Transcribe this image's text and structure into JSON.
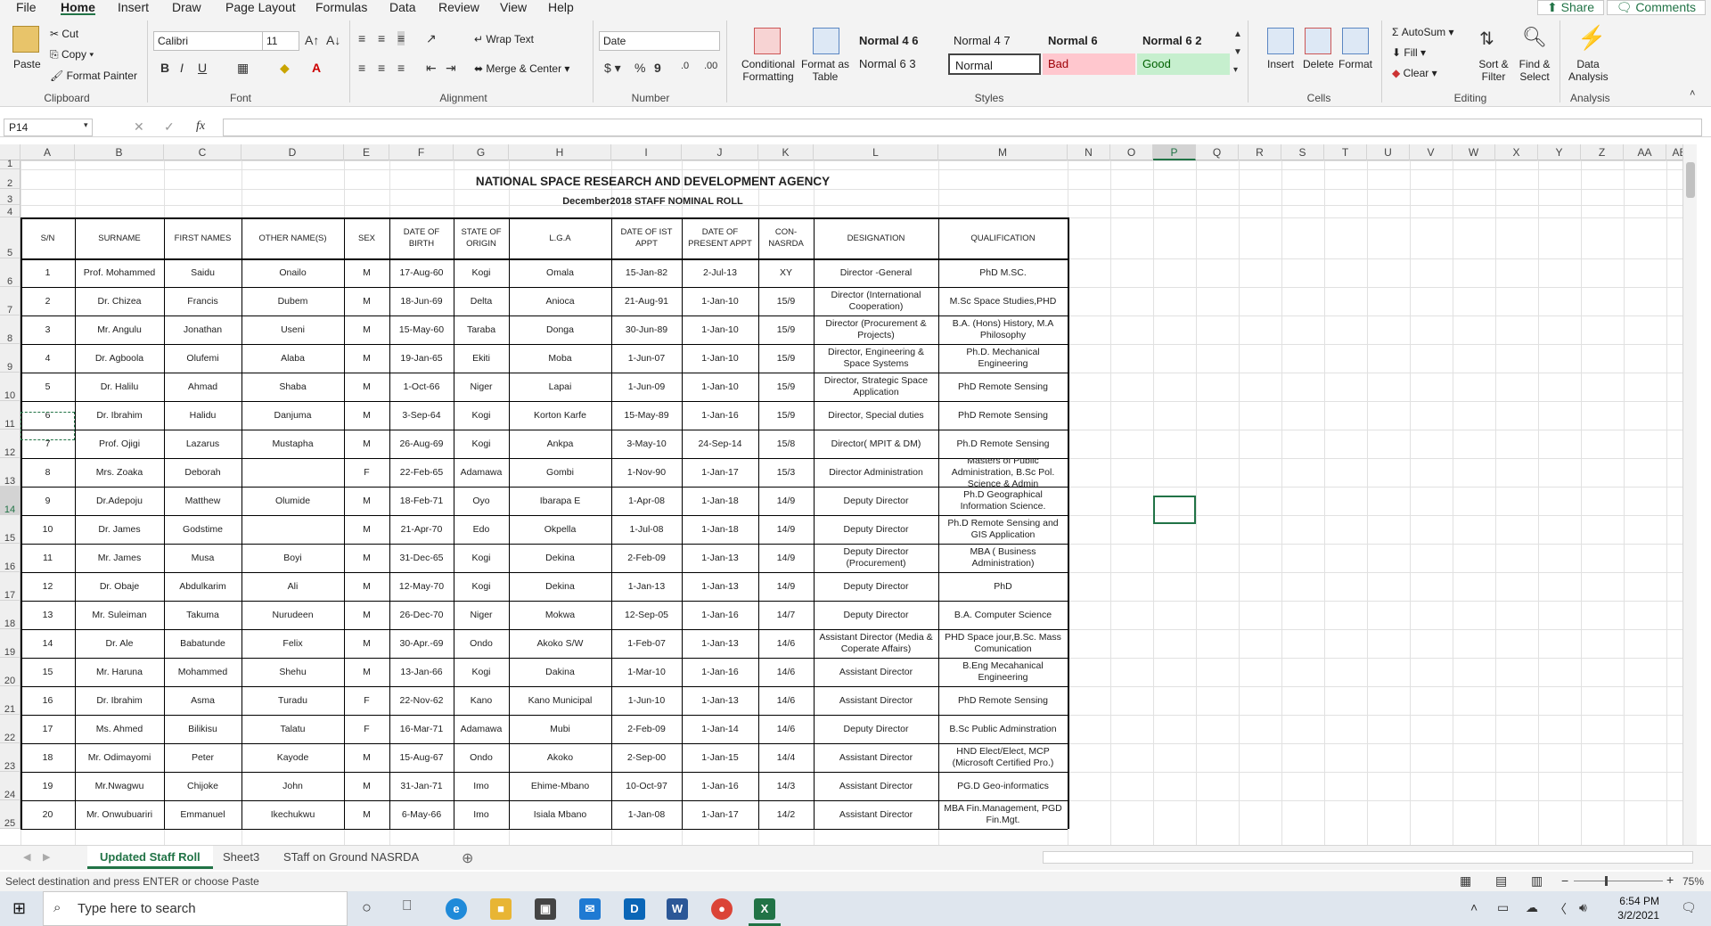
{
  "menu": {
    "tabs": [
      "File",
      "Home",
      "Insert",
      "Draw",
      "Page Layout",
      "Formulas",
      "Data",
      "Review",
      "View",
      "Help"
    ],
    "share": "Share",
    "comments": "Comments"
  },
  "ribbon": {
    "clipboard": {
      "paste": "Paste",
      "cut": "Cut",
      "copy": "Copy",
      "format_painter": "Format Painter",
      "label": "Clipboard"
    },
    "font": {
      "name": "Calibri",
      "size": "11",
      "label": "Font"
    },
    "alignment": {
      "wrap": "Wrap Text",
      "merge": "Merge & Center",
      "label": "Alignment"
    },
    "number": {
      "format": "Date",
      "label": "Number"
    },
    "styles": {
      "conditional": "Conditional Formatting",
      "format_table": "Format as Table",
      "label": "Styles",
      "cells": [
        "Normal 4 6",
        "Normal 4 7",
        "Normal 6",
        "Normal 6 2",
        "Normal 6 3",
        "Normal",
        "Bad",
        "Good"
      ]
    },
    "cells": {
      "insert": "Insert",
      "delete": "Delete",
      "format": "Format",
      "label": "Cells"
    },
    "editing": {
      "autosum": "AutoSum",
      "fill": "Fill",
      "clear": "Clear",
      "sort": "Sort & Filter",
      "find": "Find & Select",
      "label": "Editing"
    },
    "analysis": {
      "data": "Data Analysis",
      "label": "Analysis"
    }
  },
  "formula_bar": {
    "name_box": "P14",
    "fx": "fx",
    "content": ""
  },
  "columns": [
    "A",
    "B",
    "C",
    "D",
    "E",
    "F",
    "G",
    "H",
    "I",
    "J",
    "K",
    "L",
    "M",
    "N",
    "O",
    "P",
    "Q",
    "R",
    "S",
    "T",
    "U",
    "V",
    "W",
    "X",
    "Y",
    "Z",
    "AA",
    "AB"
  ],
  "rows": [
    "1",
    "2",
    "3",
    "4",
    "5",
    "6",
    "7",
    "8",
    "9",
    "10",
    "11",
    "12",
    "13",
    "14",
    "15",
    "16",
    "17",
    "18",
    "19",
    "20",
    "21",
    "22",
    "23",
    "24",
    "25"
  ],
  "sheet": {
    "title": "NATIONAL SPACE RESEARCH AND DEVELOPMENT AGENCY",
    "subtitle": "December2018 STAFF NOMINAL ROLL",
    "headers": [
      "S/N",
      "SURNAME",
      "FIRST NAMES",
      "OTHER NAME(S)",
      "SEX",
      "DATE OF BIRTH",
      "STATE OF ORIGIN",
      "L.G.A",
      "DATE OF IST APPT",
      "DATE OF PRESENT APPT",
      "CON- NASRDA",
      "DESIGNATION",
      "QUALIFICATION"
    ],
    "records": [
      [
        "1",
        "Prof. Mohammed",
        "Saidu",
        "Onailo",
        "M",
        "17-Aug-60",
        "Kogi",
        "Omala",
        "15-Jan-82",
        "2-Jul-13",
        "XY",
        "Director -General",
        "PhD  M.SC."
      ],
      [
        "2",
        "Dr. Chizea",
        "Francis",
        "Dubem",
        "M",
        "18-Jun-69",
        "Delta",
        "Anioca",
        "21-Aug-91",
        "1-Jan-10",
        "15/9",
        "Director (International Cooperation)",
        "M.Sc Space Studies,PHD"
      ],
      [
        "3",
        "Mr. Angulu",
        "Jonathan",
        "Useni",
        "M",
        "15-May-60",
        "Taraba",
        "Donga",
        "30-Jun-89",
        "1-Jan-10",
        "15/9",
        "Director (Procurement & Projects)",
        "B.A. (Hons) History, M.A Philosophy"
      ],
      [
        "4",
        "Dr. Agboola",
        "Olufemi",
        "Alaba",
        "M",
        "19-Jan-65",
        "Ekiti",
        "Moba",
        "1-Jun-07",
        "1-Jan-10",
        "15/9",
        "Director, Engineering & Space Systems",
        "Ph.D. Mechanical Engineering"
      ],
      [
        "5",
        "Dr. Halilu",
        "Ahmad",
        "Shaba",
        "M",
        "1-Oct-66",
        "Niger",
        "Lapai",
        "1-Jun-09",
        "1-Jan-10",
        "15/9",
        "Director, Strategic Space Application",
        "PhD Remote Sensing"
      ],
      [
        "6",
        "Dr. Ibrahim",
        "Halidu",
        "Danjuma",
        "M",
        "3-Sep-64",
        "Kogi",
        "Korton Karfe",
        "15-May-89",
        "1-Jan-16",
        "15/9",
        "Director, Special duties",
        "PhD Remote Sensing"
      ],
      [
        "7",
        "Prof. Ojigi",
        "Lazarus",
        "Mustapha",
        "M",
        "26-Aug-69",
        "Kogi",
        "Ankpa",
        "3-May-10",
        "24-Sep-14",
        "15/8",
        "Director( MPIT & DM)",
        "Ph.D Remote Sensing"
      ],
      [
        "8",
        "Mrs. Zoaka",
        "Deborah",
        "",
        "F",
        "22-Feb-65",
        "Adamawa",
        "Gombi",
        "1-Nov-90",
        "1-Jan-17",
        "15/3",
        "Director Administration",
        "Masters of Public Administration, B.Sc Pol. Science & Admin"
      ],
      [
        "9",
        "Dr.Adepoju",
        "Matthew",
        "Olumide",
        "M",
        "18-Feb-71",
        "Oyo",
        "Ibarapa E",
        "1-Apr-08",
        "1-Jan-18",
        "14/9",
        "Deputy Director",
        "Ph.D Geographical Information Science."
      ],
      [
        "10",
        "Dr. James",
        "Godstime",
        "",
        "M",
        "21-Apr-70",
        "Edo",
        "Okpella",
        "1-Jul-08",
        "1-Jan-18",
        "14/9",
        "Deputy Director",
        "Ph.D Remote Sensing and GIS Application"
      ],
      [
        "11",
        "Mr. James",
        "Musa",
        "Boyi",
        "M",
        "31-Dec-65",
        "Kogi",
        "Dekina",
        "2-Feb-09",
        "1-Jan-13",
        "14/9",
        "Deputy Director (Procurement)",
        "MBA ( Business Administration)"
      ],
      [
        "12",
        "Dr. Obaje",
        "Abdulkarim",
        "Ali",
        "M",
        "12-May-70",
        "Kogi",
        "Dekina",
        "1-Jan-13",
        "1-Jan-13",
        "14/9",
        "Deputy Director",
        "PhD"
      ],
      [
        "13",
        "Mr. Suleiman",
        "Takuma",
        "Nurudeen",
        "M",
        "26-Dec-70",
        "Niger",
        "Mokwa",
        "12-Sep-05",
        "1-Jan-16",
        "14/7",
        "Deputy Director",
        "B.A. Computer Science"
      ],
      [
        "14",
        "Dr. Ale",
        "Babatunde",
        "Felix",
        "M",
        "30-Apr.-69",
        "Ondo",
        "Akoko S/W",
        "1-Feb-07",
        "1-Jan-13",
        "14/6",
        "Assistant Director (Media & Coperate Affairs)",
        "PHD Space jour,B.Sc. Mass Comunication"
      ],
      [
        "15",
        "Mr. Haruna",
        "Mohammed",
        "Shehu",
        "M",
        "13-Jan-66",
        "Kogi",
        "Dakina",
        "1-Mar-10",
        "1-Jan-16",
        "14/6",
        "Assistant Director",
        "B.Eng Mecahanical Engineering"
      ],
      [
        "16",
        "Dr. Ibrahim",
        "Asma",
        "Turadu",
        "F",
        "22-Nov-62",
        "Kano",
        "Kano Municipal",
        "1-Jun-10",
        "1-Jan-13",
        "14/6",
        "Assistant Director",
        "PhD  Remote Sensing"
      ],
      [
        "17",
        "Ms. Ahmed",
        "Bilikisu",
        "Talatu",
        "F",
        "16-Mar-71",
        "Adamawa",
        "Mubi",
        "2-Feb-09",
        "1-Jan-14",
        "14/6",
        "Deputy Director",
        "B.Sc Public Adminstration"
      ],
      [
        "18",
        "Mr. Odimayomi",
        "Peter",
        "Kayode",
        "M",
        "15-Aug-67",
        "Ondo",
        "Akoko",
        "2-Sep-00",
        "1-Jan-15",
        "14/4",
        "Assistant Director",
        "HND Elect/Elect, MCP (Microsoft Certified Pro.)"
      ],
      [
        "19",
        "Mr.Nwagwu",
        "Chijoke",
        "John",
        "M",
        "31-Jan-71",
        "Imo",
        "Ehime-Mbano",
        "10-Oct-97",
        "1-Jan-16",
        "14/3",
        "Assistant Director",
        "PG.D Geo-informatics"
      ],
      [
        "20",
        "Mr. Onwubuariri",
        "Emmanuel",
        "Ikechukwu",
        "M",
        "6-May-66",
        "Imo",
        "Isiala Mbano",
        "1-Jan-08",
        "1-Jan-17",
        "14/2",
        "Assistant Director",
        "MBA Fin.Management, PGD Fin.Mgt."
      ]
    ]
  },
  "sheet_tabs": [
    "Updated Staff Roll",
    "Sheet3",
    "STaff on Ground NASRDA"
  ],
  "status": {
    "message": "Select destination and press ENTER or choose Paste",
    "zoom": "75%"
  },
  "taskbar": {
    "search": "Type here to search",
    "time": "6:54 PM",
    "date": "3/2/2021"
  },
  "colors": {
    "accent": "#217346",
    "bad_bg": "#ffc7ce",
    "bad_fg": "#9c0006",
    "good_bg": "#c6efce",
    "good_fg": "#006100"
  }
}
